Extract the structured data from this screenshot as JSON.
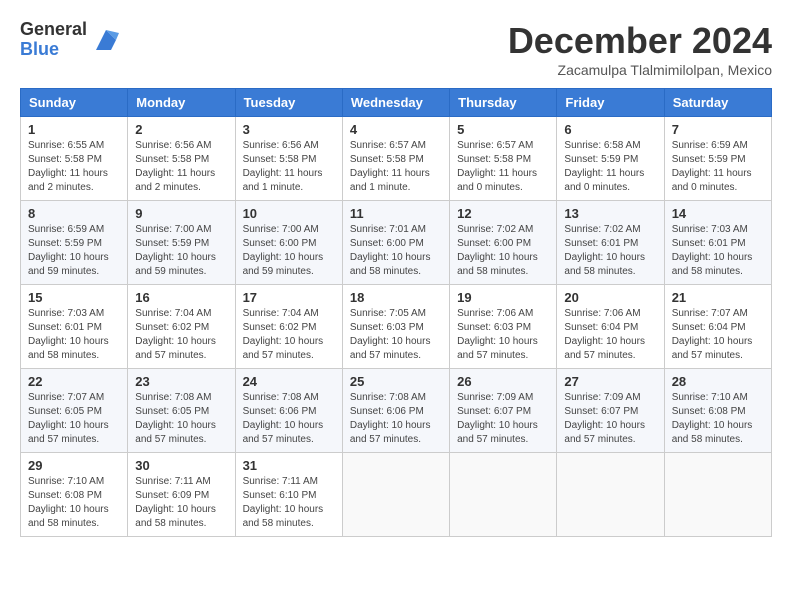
{
  "header": {
    "logo_general": "General",
    "logo_blue": "Blue",
    "title": "December 2024",
    "location": "Zacamulpa Tlalmimilolpan, Mexico"
  },
  "weekdays": [
    "Sunday",
    "Monday",
    "Tuesday",
    "Wednesday",
    "Thursday",
    "Friday",
    "Saturday"
  ],
  "weeks": [
    [
      {
        "day": 1,
        "info": "Sunrise: 6:55 AM\nSunset: 5:58 PM\nDaylight: 11 hours\nand 2 minutes."
      },
      {
        "day": 2,
        "info": "Sunrise: 6:56 AM\nSunset: 5:58 PM\nDaylight: 11 hours\nand 2 minutes."
      },
      {
        "day": 3,
        "info": "Sunrise: 6:56 AM\nSunset: 5:58 PM\nDaylight: 11 hours\nand 1 minute."
      },
      {
        "day": 4,
        "info": "Sunrise: 6:57 AM\nSunset: 5:58 PM\nDaylight: 11 hours\nand 1 minute."
      },
      {
        "day": 5,
        "info": "Sunrise: 6:57 AM\nSunset: 5:58 PM\nDaylight: 11 hours\nand 0 minutes."
      },
      {
        "day": 6,
        "info": "Sunrise: 6:58 AM\nSunset: 5:59 PM\nDaylight: 11 hours\nand 0 minutes."
      },
      {
        "day": 7,
        "info": "Sunrise: 6:59 AM\nSunset: 5:59 PM\nDaylight: 11 hours\nand 0 minutes."
      }
    ],
    [
      {
        "day": 8,
        "info": "Sunrise: 6:59 AM\nSunset: 5:59 PM\nDaylight: 10 hours\nand 59 minutes."
      },
      {
        "day": 9,
        "info": "Sunrise: 7:00 AM\nSunset: 5:59 PM\nDaylight: 10 hours\nand 59 minutes."
      },
      {
        "day": 10,
        "info": "Sunrise: 7:00 AM\nSunset: 6:00 PM\nDaylight: 10 hours\nand 59 minutes."
      },
      {
        "day": 11,
        "info": "Sunrise: 7:01 AM\nSunset: 6:00 PM\nDaylight: 10 hours\nand 58 minutes."
      },
      {
        "day": 12,
        "info": "Sunrise: 7:02 AM\nSunset: 6:00 PM\nDaylight: 10 hours\nand 58 minutes."
      },
      {
        "day": 13,
        "info": "Sunrise: 7:02 AM\nSunset: 6:01 PM\nDaylight: 10 hours\nand 58 minutes."
      },
      {
        "day": 14,
        "info": "Sunrise: 7:03 AM\nSunset: 6:01 PM\nDaylight: 10 hours\nand 58 minutes."
      }
    ],
    [
      {
        "day": 15,
        "info": "Sunrise: 7:03 AM\nSunset: 6:01 PM\nDaylight: 10 hours\nand 58 minutes."
      },
      {
        "day": 16,
        "info": "Sunrise: 7:04 AM\nSunset: 6:02 PM\nDaylight: 10 hours\nand 57 minutes."
      },
      {
        "day": 17,
        "info": "Sunrise: 7:04 AM\nSunset: 6:02 PM\nDaylight: 10 hours\nand 57 minutes."
      },
      {
        "day": 18,
        "info": "Sunrise: 7:05 AM\nSunset: 6:03 PM\nDaylight: 10 hours\nand 57 minutes."
      },
      {
        "day": 19,
        "info": "Sunrise: 7:06 AM\nSunset: 6:03 PM\nDaylight: 10 hours\nand 57 minutes."
      },
      {
        "day": 20,
        "info": "Sunrise: 7:06 AM\nSunset: 6:04 PM\nDaylight: 10 hours\nand 57 minutes."
      },
      {
        "day": 21,
        "info": "Sunrise: 7:07 AM\nSunset: 6:04 PM\nDaylight: 10 hours\nand 57 minutes."
      }
    ],
    [
      {
        "day": 22,
        "info": "Sunrise: 7:07 AM\nSunset: 6:05 PM\nDaylight: 10 hours\nand 57 minutes."
      },
      {
        "day": 23,
        "info": "Sunrise: 7:08 AM\nSunset: 6:05 PM\nDaylight: 10 hours\nand 57 minutes."
      },
      {
        "day": 24,
        "info": "Sunrise: 7:08 AM\nSunset: 6:06 PM\nDaylight: 10 hours\nand 57 minutes."
      },
      {
        "day": 25,
        "info": "Sunrise: 7:08 AM\nSunset: 6:06 PM\nDaylight: 10 hours\nand 57 minutes."
      },
      {
        "day": 26,
        "info": "Sunrise: 7:09 AM\nSunset: 6:07 PM\nDaylight: 10 hours\nand 57 minutes."
      },
      {
        "day": 27,
        "info": "Sunrise: 7:09 AM\nSunset: 6:07 PM\nDaylight: 10 hours\nand 57 minutes."
      },
      {
        "day": 28,
        "info": "Sunrise: 7:10 AM\nSunset: 6:08 PM\nDaylight: 10 hours\nand 58 minutes."
      }
    ],
    [
      {
        "day": 29,
        "info": "Sunrise: 7:10 AM\nSunset: 6:08 PM\nDaylight: 10 hours\nand 58 minutes."
      },
      {
        "day": 30,
        "info": "Sunrise: 7:11 AM\nSunset: 6:09 PM\nDaylight: 10 hours\nand 58 minutes."
      },
      {
        "day": 31,
        "info": "Sunrise: 7:11 AM\nSunset: 6:10 PM\nDaylight: 10 hours\nand 58 minutes."
      },
      null,
      null,
      null,
      null
    ]
  ]
}
